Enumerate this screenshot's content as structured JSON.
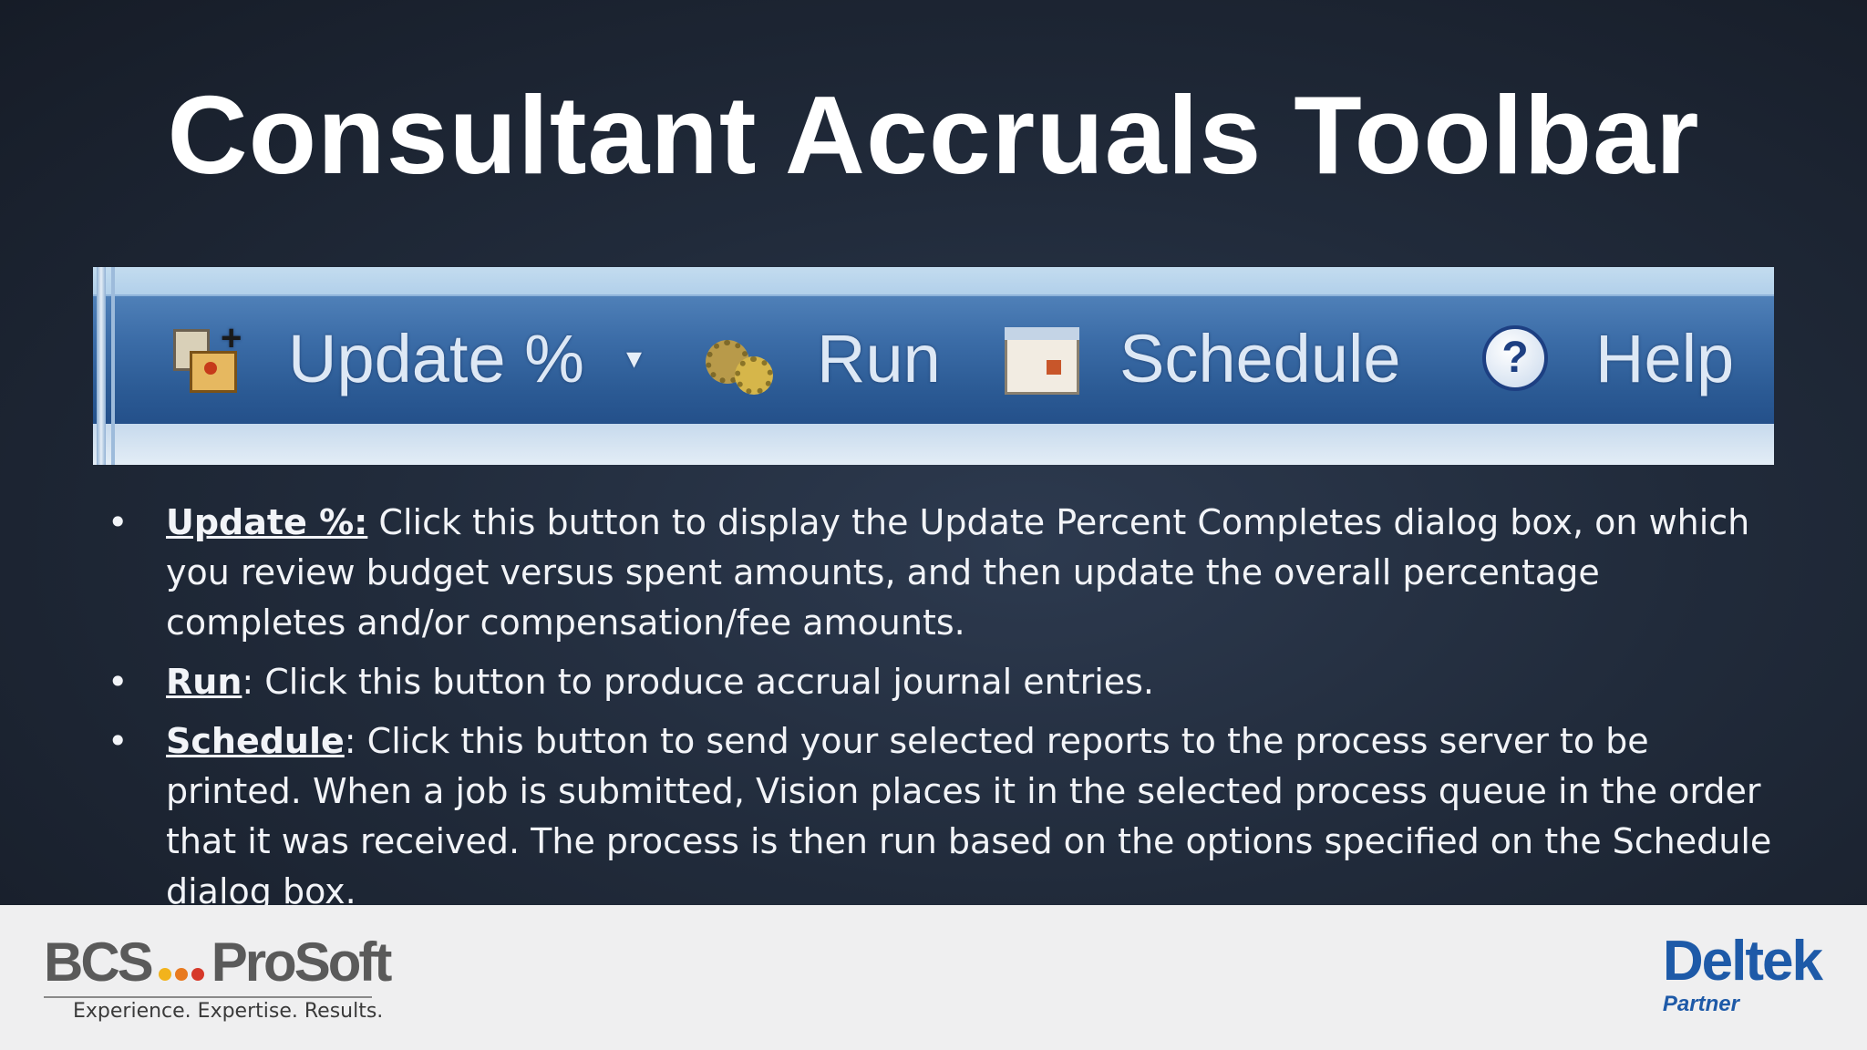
{
  "slide": {
    "title": "Consultant Accruals Toolbar"
  },
  "toolbar": {
    "update_label": "Update %",
    "caret": "▾",
    "run_label": "Run",
    "schedule_label": "Schedule",
    "help_label": "Help",
    "icons": {
      "update": "update-percent-icon",
      "run": "gears-icon",
      "schedule": "calendar-icon",
      "help": "question-mark-icon"
    }
  },
  "bullets": [
    {
      "term": "Update %:",
      "text": " Click this button to display the Update Percent Completes dialog box, on which you review budget versus spent amounts, and then update the overall percentage completes and/or compensation/fee amounts."
    },
    {
      "term": "Run",
      "text": ": Click this button to produce accrual journal entries."
    },
    {
      "term": "Schedule",
      "text": ": Click this button to send your selected reports to the process server to be printed. When a job is submitted, Vision places it in the selected process queue in the order that it was received. The process is then run based on the options specified on the Schedule dialog box."
    }
  ],
  "footer": {
    "bcs_left": "BCS",
    "bcs_right": "ProSoft",
    "bcs_tagline": "Experience. Expertise. Results.",
    "deltek_name": "Deltek",
    "deltek_partner": "Partner",
    "colors": {
      "dot1": "#f2b31c",
      "dot2": "#e87a1f",
      "dot3": "#d6392a",
      "deltek_blue": "#1e5aa8"
    }
  }
}
